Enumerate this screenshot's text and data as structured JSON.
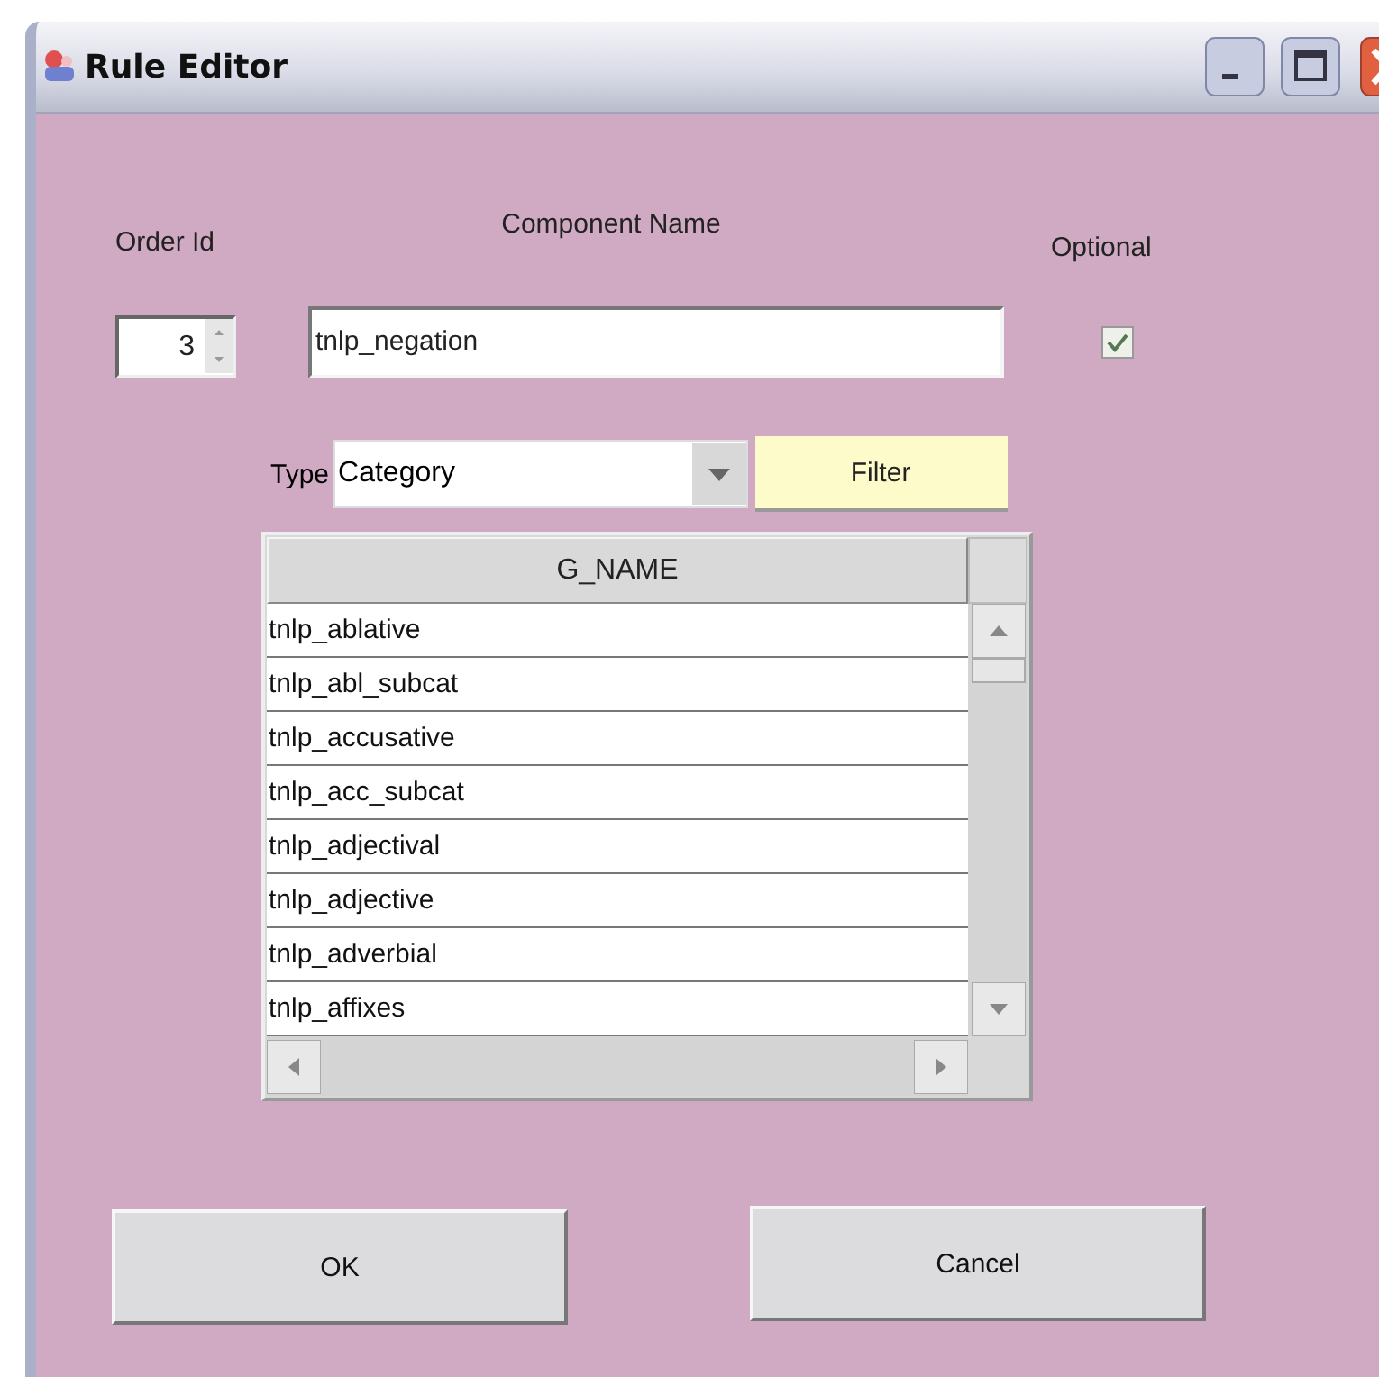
{
  "window": {
    "title": "Rule Editor"
  },
  "labels": {
    "order_id": "Order Id",
    "component_name": "Component Name",
    "optional": "Optional"
  },
  "order_id": {
    "value": "3"
  },
  "component_name": {
    "value": "tnlp_negation"
  },
  "optional": {
    "checked": true
  },
  "type": {
    "label": "Type",
    "value": "Category"
  },
  "filter_button": "Filter",
  "table": {
    "columns": [
      "G_NAME"
    ],
    "rows": [
      "tnlp_ablative",
      "tnlp_abl_subcat",
      "tnlp_accusative",
      "tnlp_acc_subcat",
      "tnlp_adjectival",
      "tnlp_adjective",
      "tnlp_adverbial",
      "tnlp_affixes"
    ]
  },
  "buttons": [
    "OK",
    "Cancel"
  ]
}
